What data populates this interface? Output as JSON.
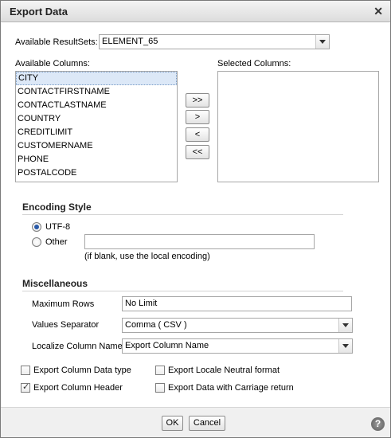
{
  "dialog": {
    "title": "Export Data"
  },
  "resultsets": {
    "label": "Available ResultSets:",
    "value": "ELEMENT_65"
  },
  "available_columns": {
    "label": "Available Columns:",
    "items": [
      "CITY",
      "CONTACTFIRSTNAME",
      "CONTACTLASTNAME",
      "COUNTRY",
      "CREDITLIMIT",
      "CUSTOMERNAME",
      "PHONE",
      "POSTALCODE"
    ]
  },
  "selected_columns": {
    "label": "Selected Columns:"
  },
  "transfer_buttons": {
    "add_all": ">>",
    "add": ">",
    "remove": "<",
    "remove_all": "<<"
  },
  "encoding": {
    "title": "Encoding Style",
    "utf8_label": "UTF-8",
    "other_label": "Other",
    "other_value": "",
    "hint": "(if blank, use the local encoding)"
  },
  "misc": {
    "title": "Miscellaneous",
    "max_rows_label": "Maximum Rows",
    "max_rows_value": "No Limit",
    "separator_label": "Values Separator",
    "separator_value": "Comma ( CSV )",
    "localize_label": "Localize Column Name",
    "localize_value": "Export Column Name"
  },
  "options": {
    "data_type": "Export Column Data type",
    "header": "Export Column Header",
    "locale_neutral": "Export Locale Neutral format",
    "carriage_return": "Export Data with Carriage return"
  },
  "footer": {
    "ok": "OK",
    "cancel": "Cancel",
    "help": "?"
  }
}
